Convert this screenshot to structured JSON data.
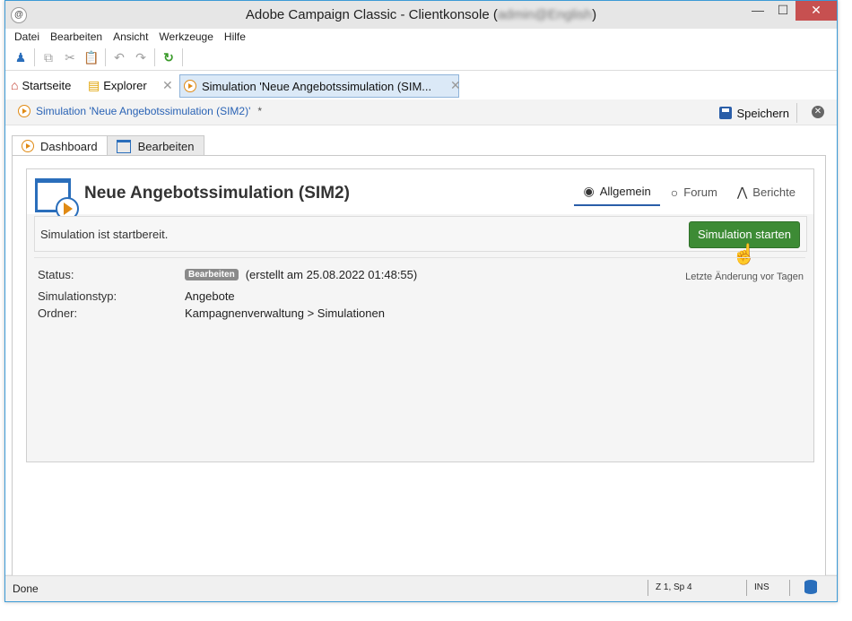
{
  "window": {
    "title": "Adobe Campaign Classic - Clientkonsole (",
    "title_user": "admin@English",
    "title_close_paren": ")",
    "controls": {
      "minimize": "—",
      "maximize": "☐",
      "close": "✕"
    }
  },
  "menubar": {
    "items": [
      "Datei",
      "Bearbeiten",
      "Ansicht",
      "Werkzeuge",
      "Hilfe"
    ]
  },
  "toolbar": {
    "icons": [
      "add-user-icon",
      "copy-icon",
      "cut-icon",
      "paste-icon",
      "undo-icon",
      "redo-icon",
      "refresh-icon"
    ]
  },
  "tabs": {
    "home": "Startseite",
    "explorer": "Explorer",
    "active": "Simulation 'Neue Angebotssimulation (SIM..."
  },
  "doc": {
    "title": "Simulation 'Neue Angebotssimulation (SIM2)'",
    "modified_marker": "*",
    "save_label": "Speichern"
  },
  "subtabs": {
    "dashboard": "Dashboard",
    "edit": "Bearbeiten"
  },
  "card": {
    "title": "Neue Angebotssimulation (SIM2)",
    "tabs": {
      "general": "Allgemein",
      "forum": "Forum",
      "reports": "Berichte"
    },
    "ready_text": "Simulation ist startbereit.",
    "start_button": "Simulation starten",
    "properties": {
      "status_label": "Status:",
      "status_badge": "Bearbeiten",
      "status_text": "(erstellt am 25.08.2022 01:48:55)",
      "type_label": "Simulationstyp:",
      "type_value": "Angebote",
      "folder_label": "Ordner:",
      "folder_value": "Kampagnenverwaltung > Simulationen"
    },
    "last_change": "Letzte Änderung vor  Tagen"
  },
  "statusbar": {
    "text": "Done",
    "position": "Z 1, Sp 4",
    "mode": "INS"
  },
  "colors": {
    "accent": "#2a6ebb",
    "start_button": "#3d8b35",
    "play_icon": "#e08a14"
  }
}
